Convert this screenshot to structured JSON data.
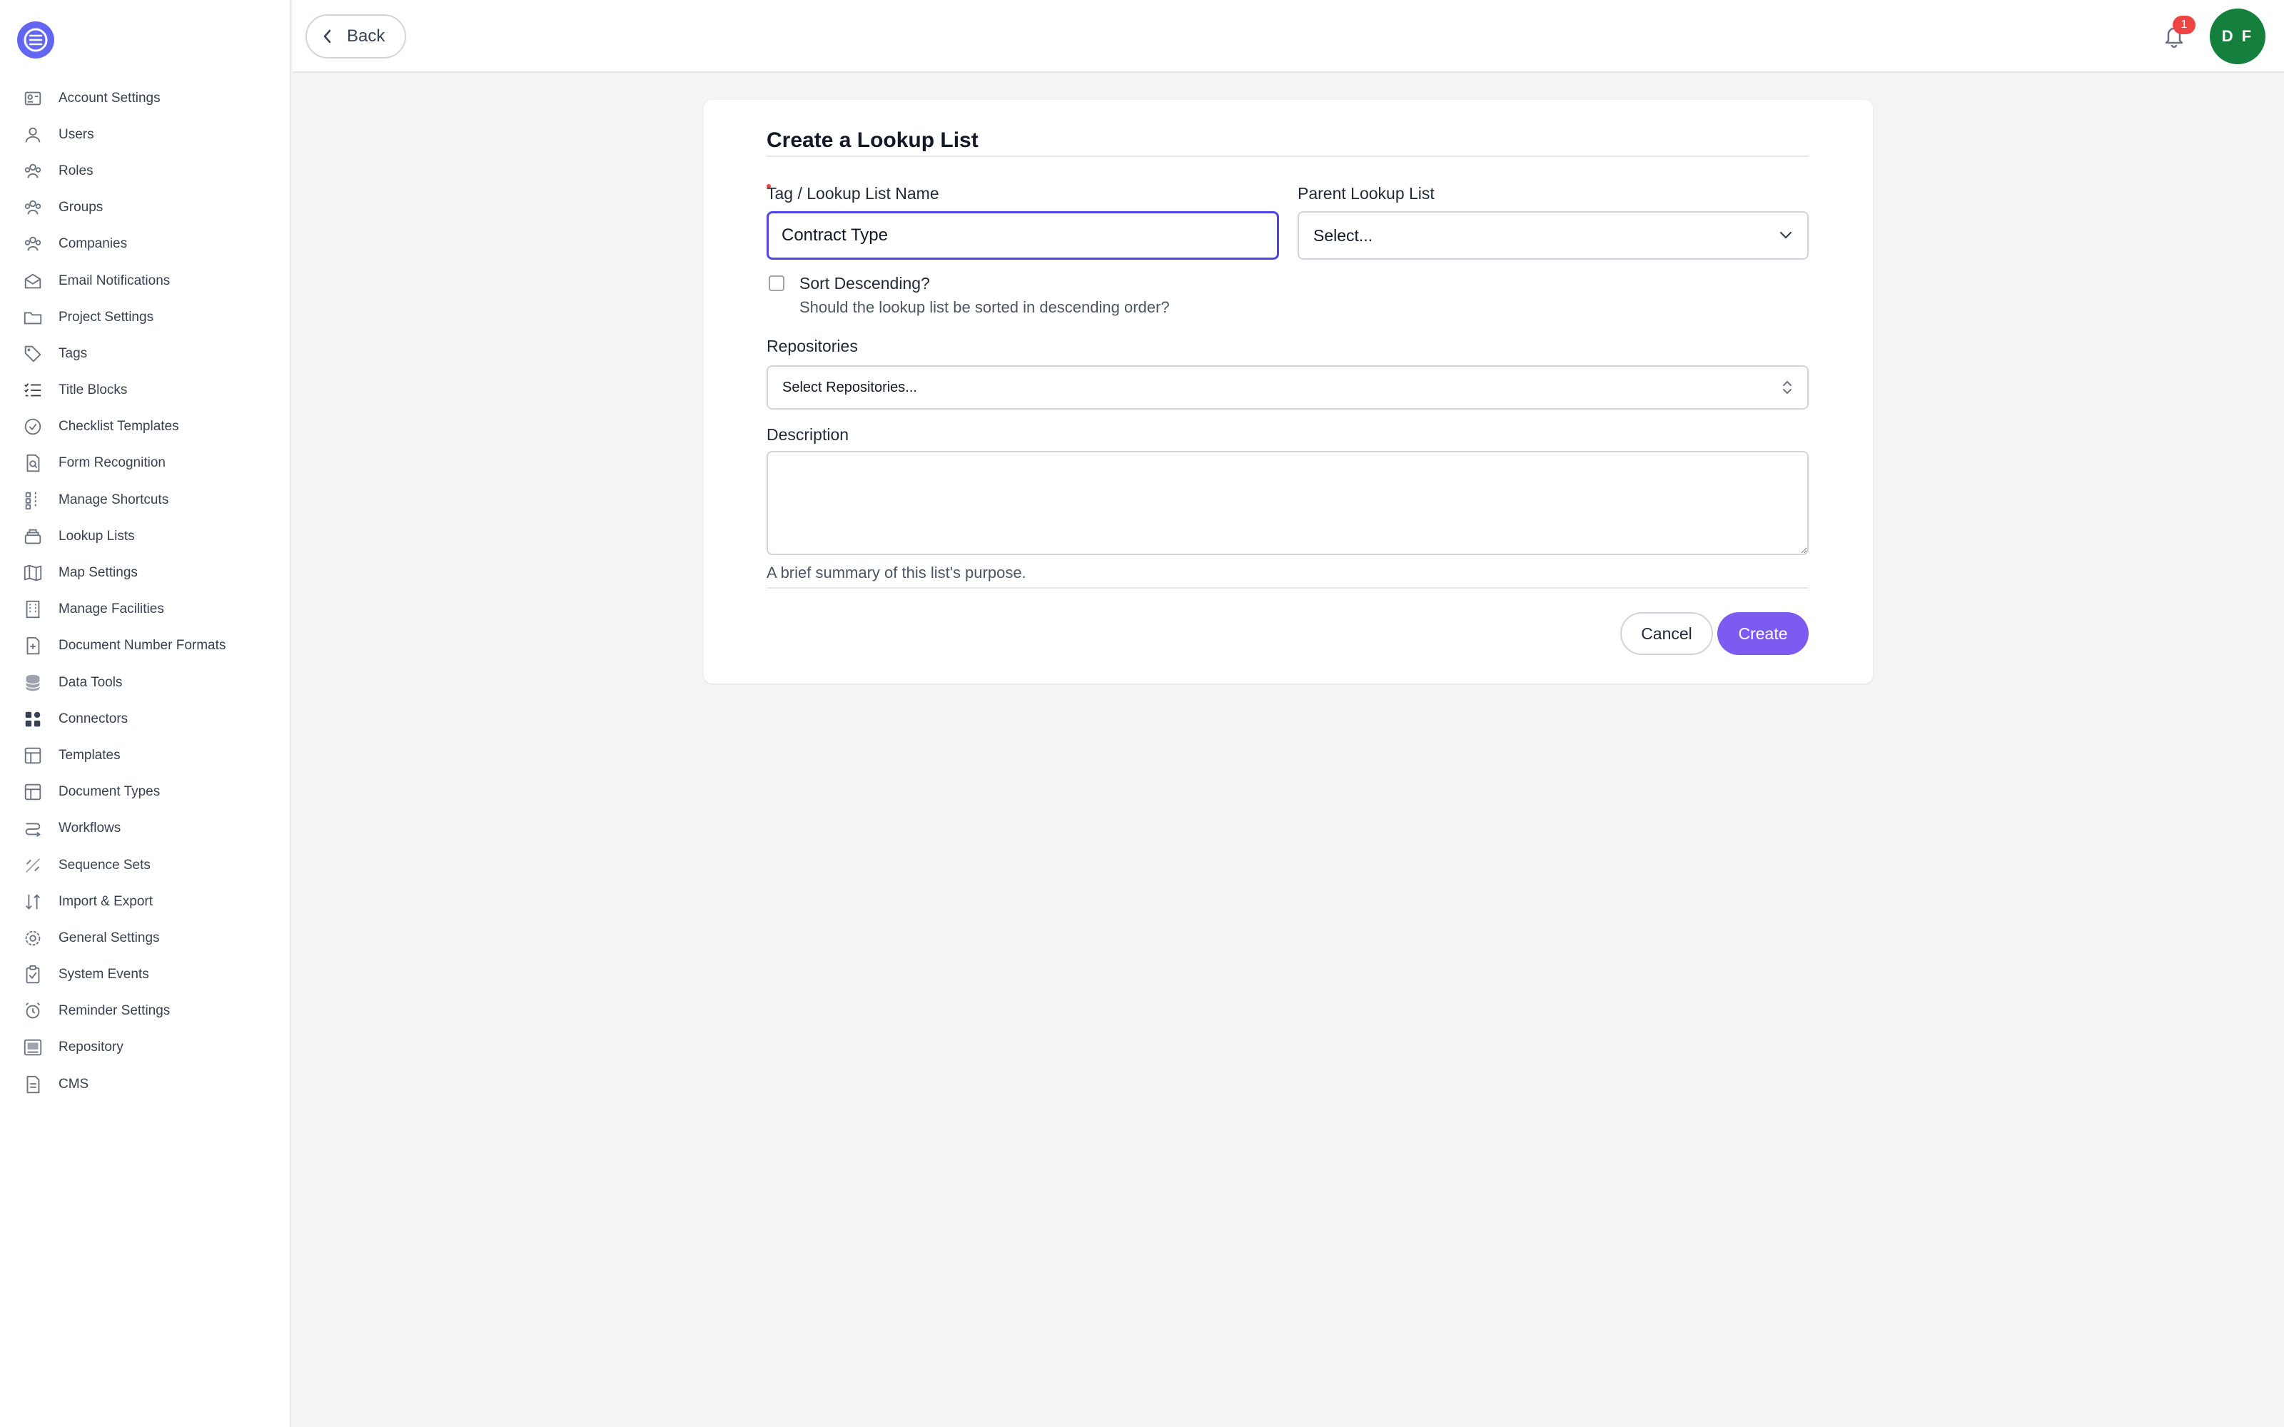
{
  "sidebar": {
    "items": [
      {
        "label": "Account Settings",
        "icon": "id-card-icon"
      },
      {
        "label": "Users",
        "icon": "user-icon"
      },
      {
        "label": "Roles",
        "icon": "users-group-icon"
      },
      {
        "label": "Groups",
        "icon": "users-group-icon"
      },
      {
        "label": "Companies",
        "icon": "users-group-icon"
      },
      {
        "label": "Email Notifications",
        "icon": "envelope-open-icon"
      },
      {
        "label": "Project Settings",
        "icon": "folder-icon"
      },
      {
        "label": "Tags",
        "icon": "tag-icon"
      },
      {
        "label": "Title Blocks",
        "icon": "checklist-icon"
      },
      {
        "label": "Checklist Templates",
        "icon": "check-circle-icon"
      },
      {
        "label": "Form Recognition",
        "icon": "document-search-icon"
      },
      {
        "label": "Manage Shortcuts",
        "icon": "shortcut-icon"
      },
      {
        "label": "Lookup Lists",
        "icon": "stack-icon"
      },
      {
        "label": "Map Settings",
        "icon": "map-icon"
      },
      {
        "label": "Manage Facilities",
        "icon": "building-icon"
      },
      {
        "label": "Document Number Formats",
        "icon": "document-plus-icon"
      },
      {
        "label": "Data Tools",
        "icon": "database-icon"
      },
      {
        "label": "Connectors",
        "icon": "apps-icon"
      },
      {
        "label": "Templates",
        "icon": "layout-icon"
      },
      {
        "label": "Document Types",
        "icon": "layout-icon"
      },
      {
        "label": "Workflows",
        "icon": "workflow-icon"
      },
      {
        "label": "Sequence Sets",
        "icon": "sequence-icon"
      },
      {
        "label": "Import & Export",
        "icon": "arrows-up-down-icon"
      },
      {
        "label": "General Settings",
        "icon": "gear-icon"
      },
      {
        "label": "System Events",
        "icon": "clipboard-check-icon"
      },
      {
        "label": "Reminder Settings",
        "icon": "alarm-clock-icon"
      },
      {
        "label": "Repository",
        "icon": "inbox-icon"
      },
      {
        "label": "CMS",
        "icon": "document-icon"
      }
    ]
  },
  "topbar": {
    "back_label": "Back",
    "notification_count": "1",
    "avatar_initials": "D F"
  },
  "form": {
    "title": "Create a Lookup List",
    "name_label": "Tag / Lookup List Name",
    "name_value": "Contract Type",
    "parent_label": "Parent Lookup List",
    "parent_value": "Select...",
    "sort_label": "Sort Descending?",
    "sort_help": "Should the lookup list be sorted in descending order?",
    "sort_checked": false,
    "repositories_label": "Repositories",
    "repositories_value": "Select Repositories...",
    "description_label": "Description",
    "description_value": "",
    "description_help": "A brief summary of this list's purpose.",
    "cancel_label": "Cancel",
    "create_label": "Create"
  },
  "colors": {
    "accent": "#7c5cf0",
    "focus_border": "#4f46e5",
    "logo": "#6366f1",
    "avatar": "#15803d",
    "badge": "#ef4444",
    "page_bg": "#f3f4f6"
  }
}
